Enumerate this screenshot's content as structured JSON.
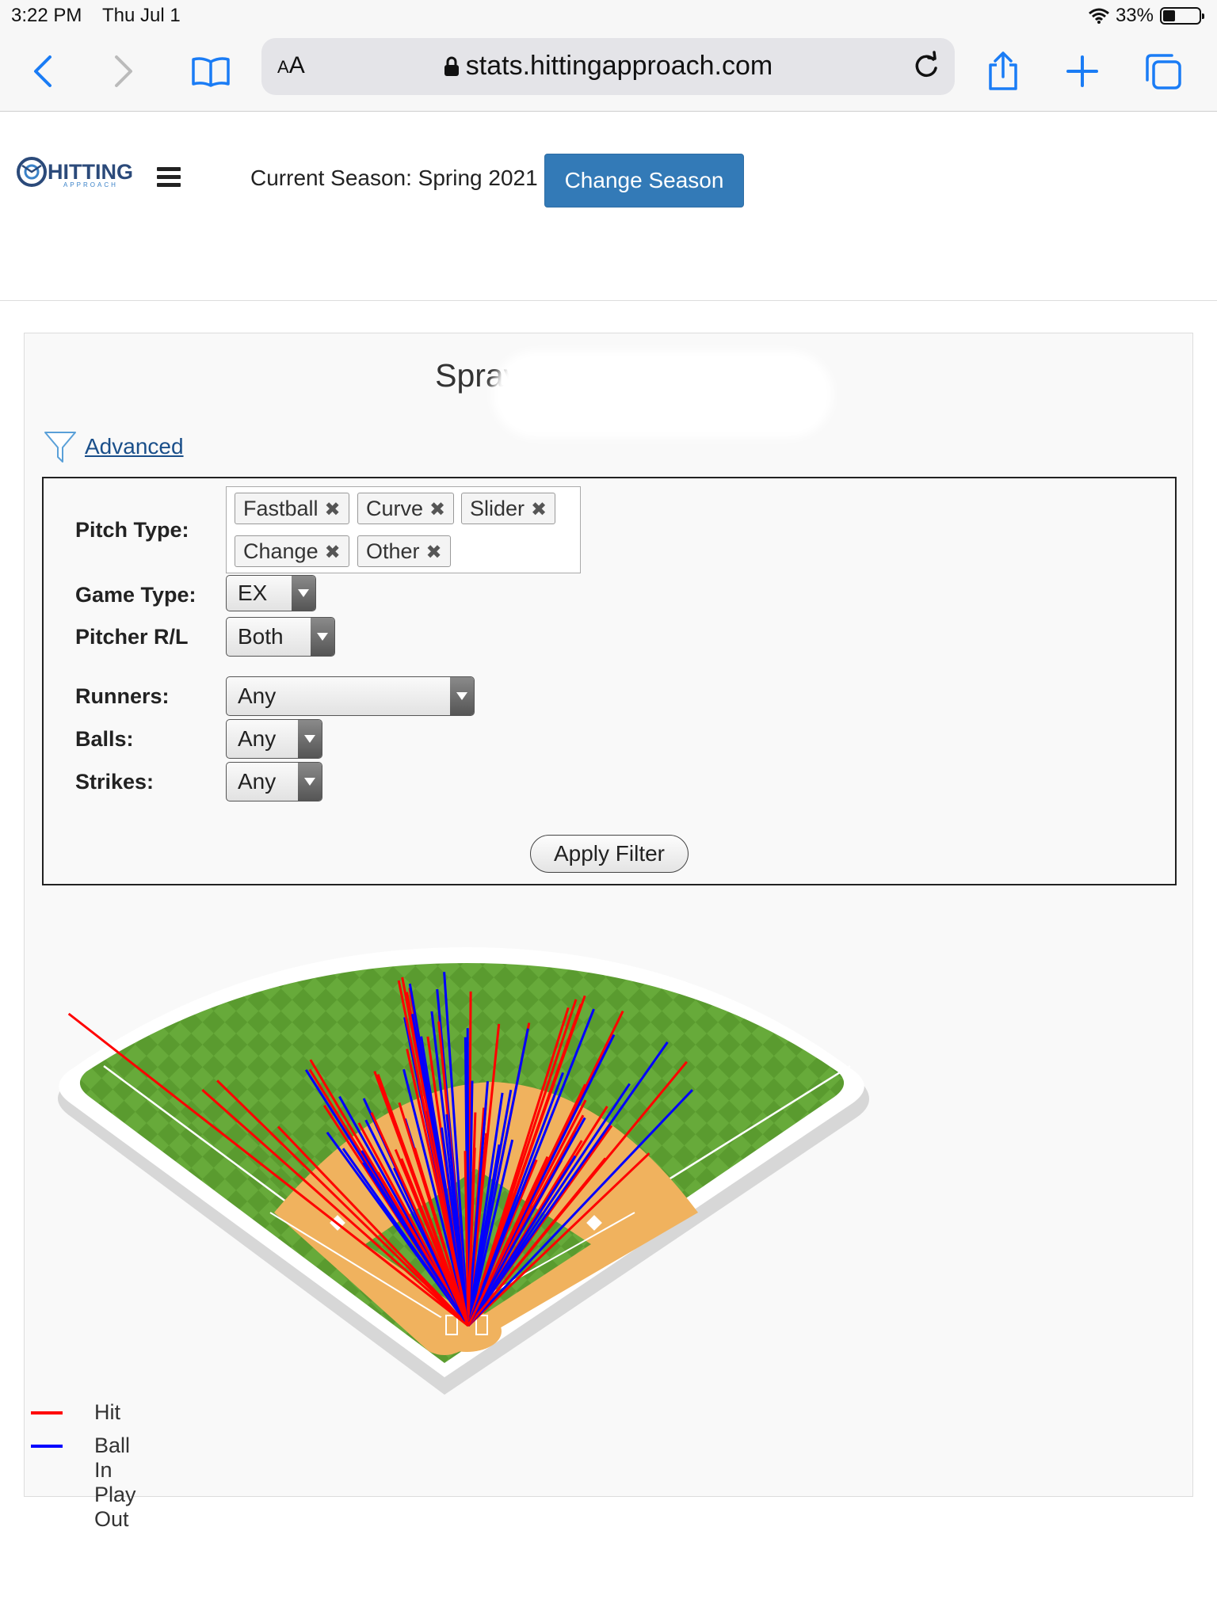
{
  "status_bar": {
    "time": "3:22 PM",
    "date": "Thu Jul 1",
    "battery": "33%",
    "battery_level": 0.33
  },
  "browser": {
    "aa_label": "AA",
    "url": "stats.hittingapproach.com",
    "icons": [
      "back-icon",
      "forward-icon",
      "bookmarks-icon",
      "lock-icon",
      "reload-icon",
      "share-icon",
      "new-tab-icon",
      "tabs-icon"
    ]
  },
  "header": {
    "logo_text": "HITTING",
    "logo_sub": "APPROACH",
    "season_text": "Current Season: Spring 2021",
    "change_season_label": "Change Season"
  },
  "chart_section": {
    "title": "Spray Chart",
    "advanced_label": "Advanced"
  },
  "filters": {
    "pitch_type": {
      "label": "Pitch Type:",
      "chips": [
        "Fastball",
        "Curve",
        "Slider",
        "Change",
        "Other"
      ],
      "remove_glyph": "✖"
    },
    "game_type": {
      "label": "Game Type:",
      "value": "EX"
    },
    "pitcher_rl": {
      "label": "Pitcher R/L",
      "value": "Both"
    },
    "runners": {
      "label": "Runners:",
      "value": "Any"
    },
    "balls": {
      "label": "Balls:",
      "value": "Any"
    },
    "strikes": {
      "label": "Strikes:",
      "value": "Any"
    },
    "apply_label": "Apply Filter"
  },
  "legend": [
    {
      "label": "Hit",
      "color": "#ff0000"
    },
    {
      "label": "Ball In Play Out",
      "color": "#0000ff"
    }
  ],
  "colors": {
    "hit": "#ff0000",
    "out": "#0000ff",
    "grass": "#5a9b2f",
    "infield_dirt": "#f0b25e",
    "accent": "#337ab7"
  }
}
